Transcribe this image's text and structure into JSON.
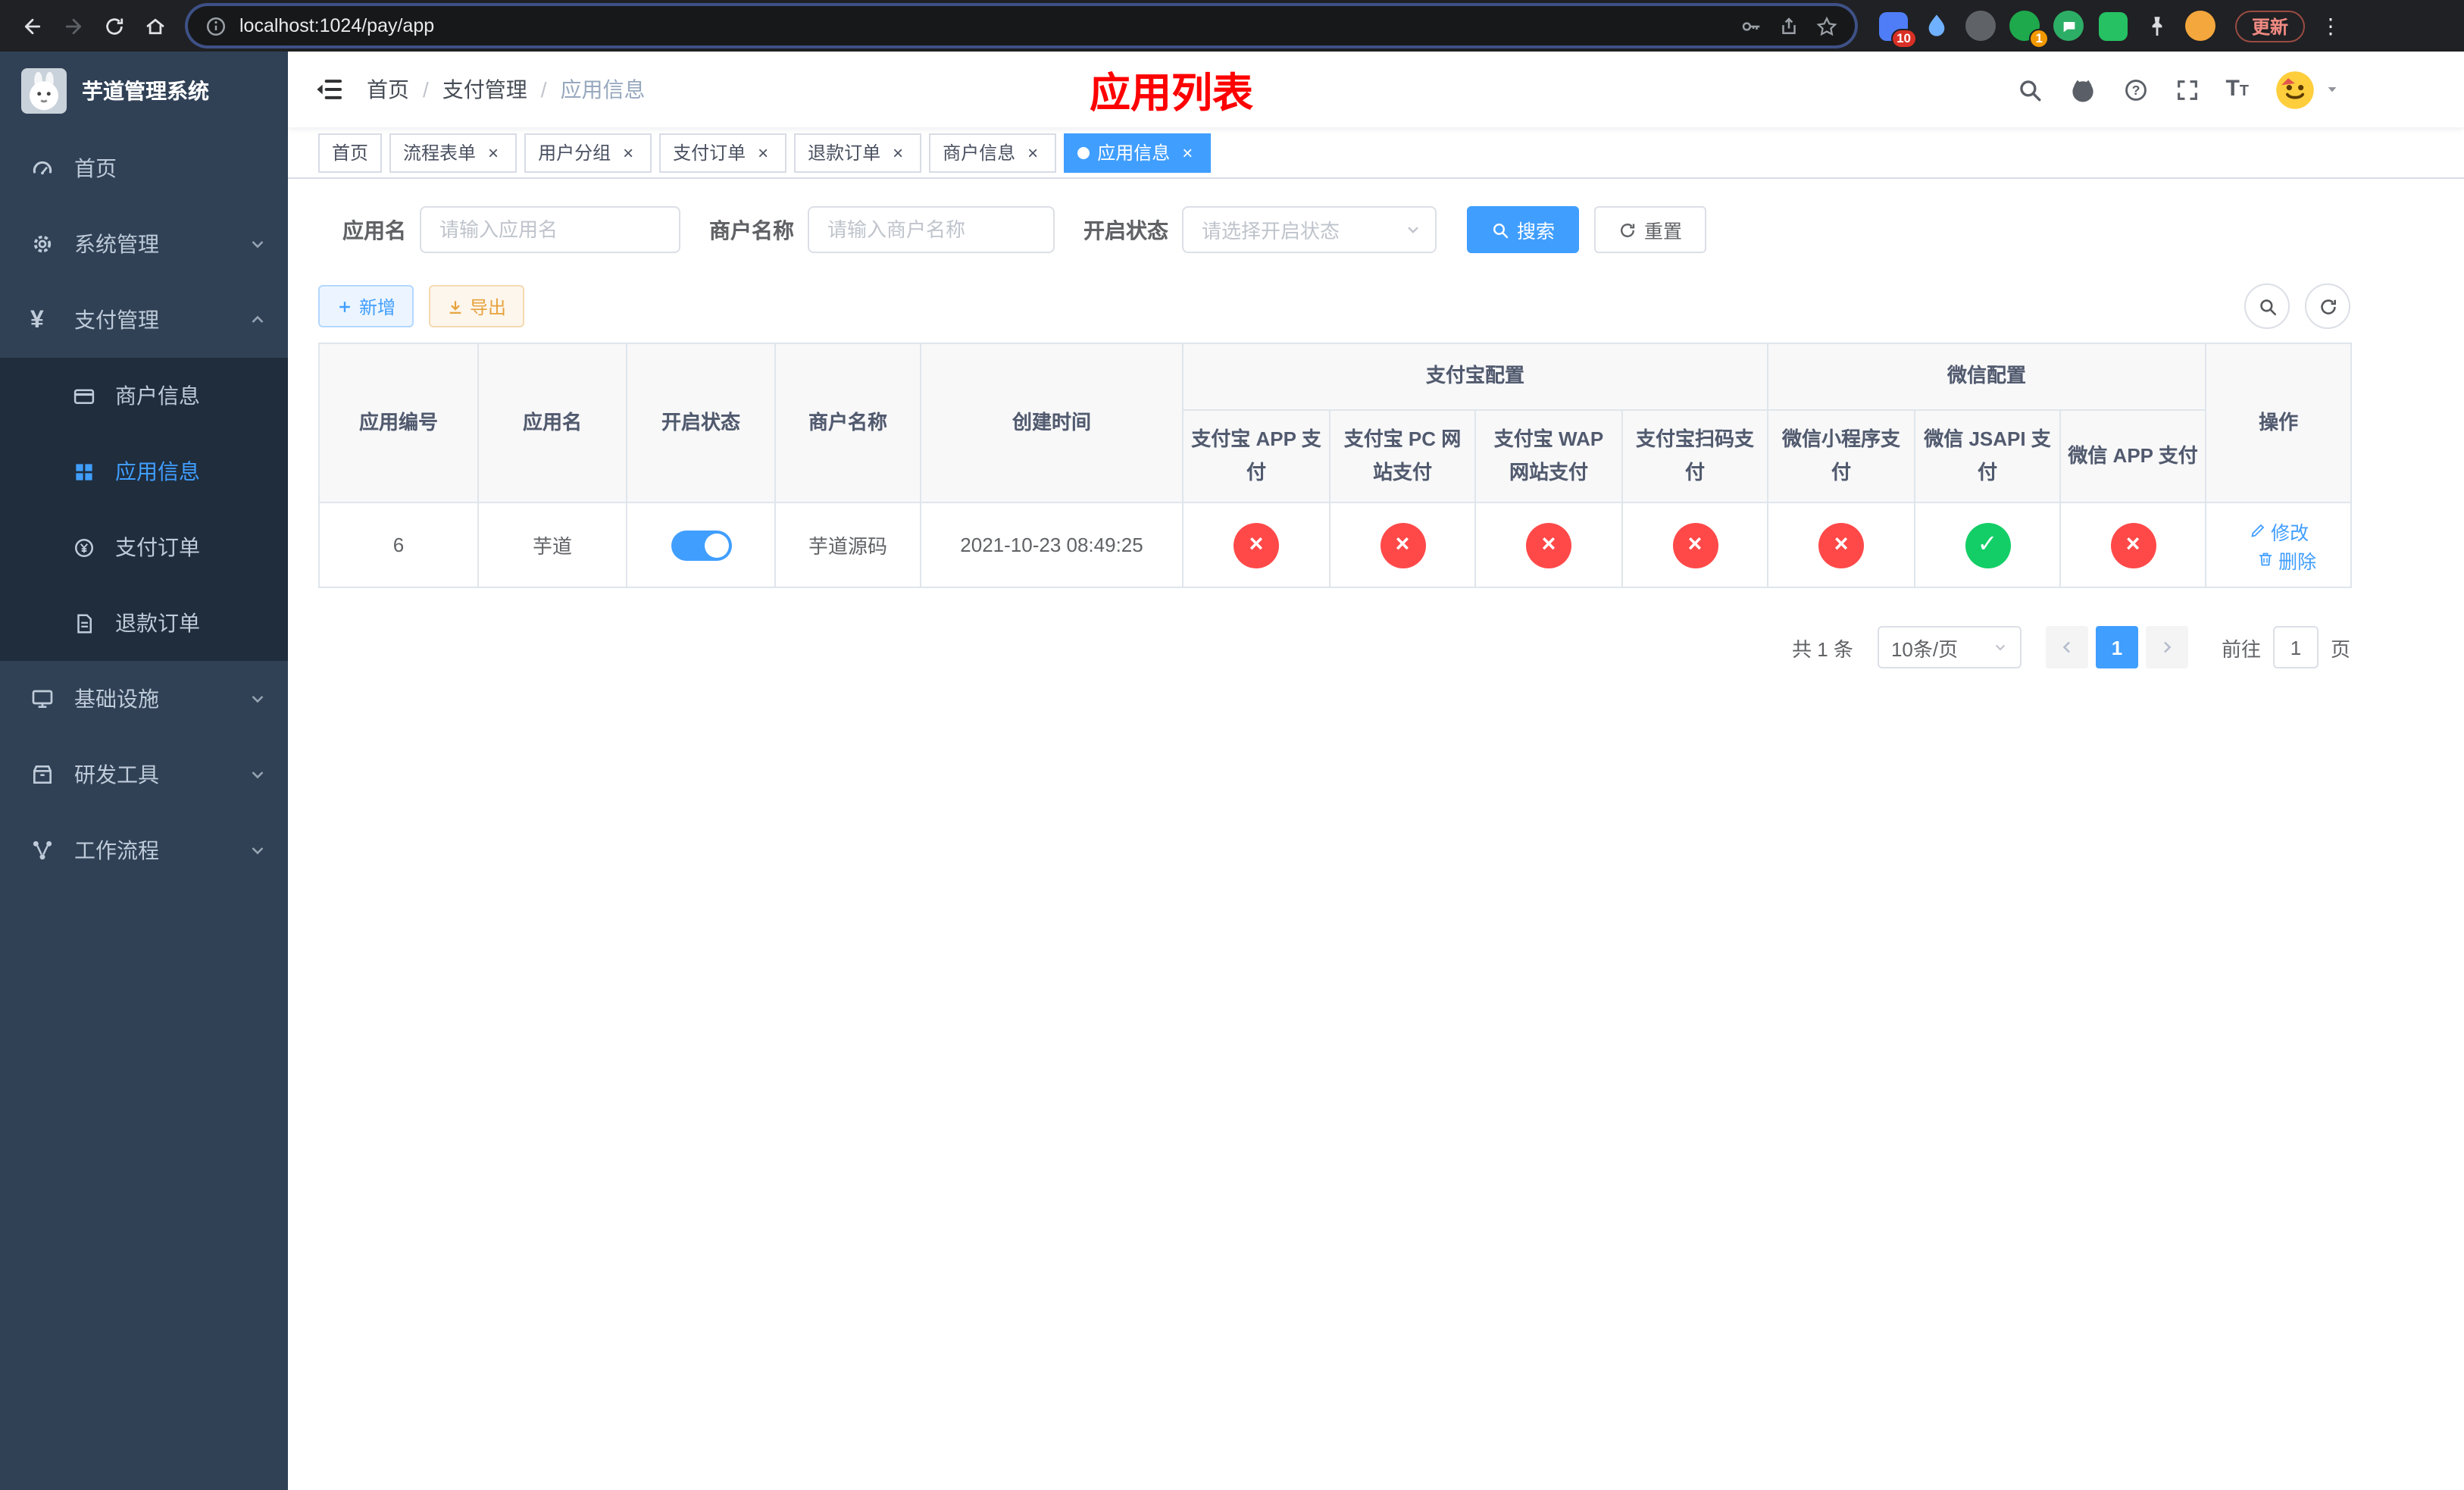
{
  "colors": {
    "accent": "#409EFF",
    "danger": "#ff4949",
    "success": "#13ce66",
    "warning": "#E6A23C",
    "title_red": "#FF0000",
    "sidebar_bg": "#304156",
    "submenu_bg": "#1f2d3d"
  },
  "browser": {
    "url": "localhost:1024/pay/app",
    "update_label": "更新",
    "ext_badge_puzzle": "10",
    "ext_badge_green": "1"
  },
  "sidebar": {
    "title": "芋道管理系统",
    "items": [
      {
        "label": "首页",
        "icon": "dashboard"
      },
      {
        "label": "系统管理",
        "icon": "gear",
        "expandable": true
      },
      {
        "label": "支付管理",
        "icon": "yen",
        "expanded": true,
        "children": [
          {
            "label": "商户信息",
            "icon": "card"
          },
          {
            "label": "应用信息",
            "icon": "grid",
            "active": true
          },
          {
            "label": "支付订单",
            "icon": "coin"
          },
          {
            "label": "退款订单",
            "icon": "doc"
          }
        ]
      },
      {
        "label": "基础设施",
        "icon": "monitor",
        "expandable": true
      },
      {
        "label": "研发工具",
        "icon": "box",
        "expandable": true
      },
      {
        "label": "工作流程",
        "icon": "flow",
        "expandable": true
      }
    ]
  },
  "navbar": {
    "breadcrumb": [
      "首页",
      "支付管理",
      "应用信息"
    ],
    "title": "应用列表"
  },
  "tabs": [
    {
      "label": "首页",
      "closable": false,
      "active": false
    },
    {
      "label": "流程表单",
      "closable": true,
      "active": false
    },
    {
      "label": "用户分组",
      "closable": true,
      "active": false
    },
    {
      "label": "支付订单",
      "closable": true,
      "active": false
    },
    {
      "label": "退款订单",
      "closable": true,
      "active": false
    },
    {
      "label": "商户信息",
      "closable": true,
      "active": false
    },
    {
      "label": "应用信息",
      "closable": true,
      "active": true
    }
  ],
  "filters": {
    "app_name_label": "应用名",
    "app_name_placeholder": "请输入应用名",
    "merchant_label": "商户名称",
    "merchant_placeholder": "请输入商户名称",
    "status_label": "开启状态",
    "status_placeholder": "请选择开启状态",
    "search_label": "搜索",
    "reset_label": "重置"
  },
  "toolbar": {
    "add_label": "新增",
    "export_label": "导出"
  },
  "table": {
    "group_alipay": "支付宝配置",
    "group_wechat": "微信配置",
    "columns": [
      "应用编号",
      "应用名",
      "开启状态",
      "商户名称",
      "创建时间",
      "支付宝 APP 支付",
      "支付宝 PC 网站支付",
      "支付宝 WAP 网站支付",
      "支付宝扫码支付",
      "微信小程序支付",
      "微信 JSAPI 支付",
      "微信 APP 支付",
      "操作"
    ],
    "rows": [
      {
        "id": "6",
        "name": "芋道",
        "enabled": true,
        "merchant": "芋道源码",
        "created": "2021-10-23 08:49:25",
        "alipay_app": false,
        "alipay_pc": false,
        "alipay_wap": false,
        "alipay_qr": false,
        "wx_mini": false,
        "wx_jsapi": true,
        "wx_app": false,
        "edit_label": "修改",
        "delete_label": "删除"
      }
    ]
  },
  "pagination": {
    "total": "共 1 条",
    "page_size": "10条/页",
    "current": "1",
    "goto_label": "前往",
    "goto_value": "1",
    "unit": "页"
  }
}
